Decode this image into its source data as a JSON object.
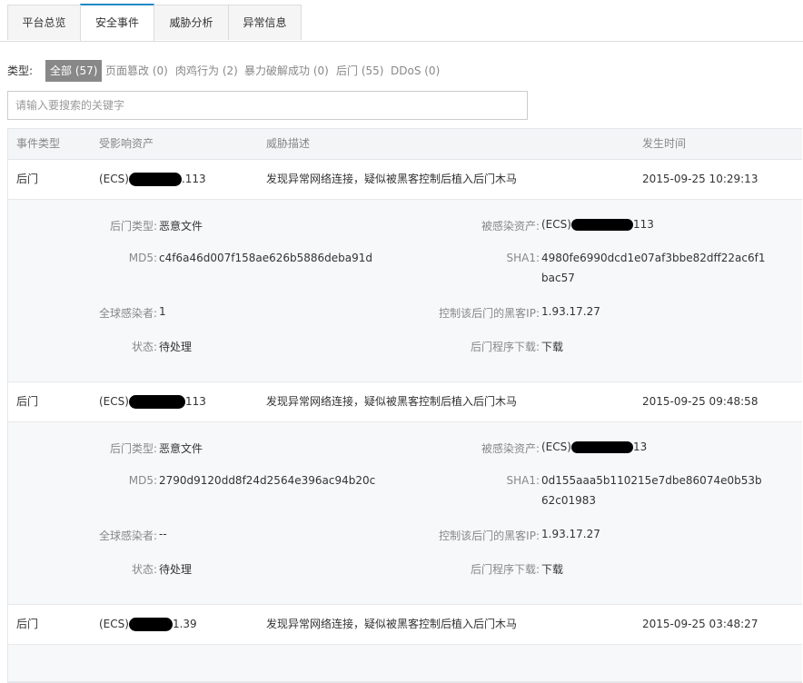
{
  "tabs": [
    {
      "label": "平台总览",
      "active": false
    },
    {
      "label": "安全事件",
      "active": true
    },
    {
      "label": "威胁分析",
      "active": false
    },
    {
      "label": "异常信息",
      "active": false
    }
  ],
  "filter": {
    "label": "类型:",
    "options": [
      {
        "label": "全部 (57)",
        "selected": true
      },
      {
        "label": "页面篡改 (0)"
      },
      {
        "label": "肉鸡行为 (2)"
      },
      {
        "label": "暴力破解成功 (0)"
      },
      {
        "label": "后门 (55)"
      },
      {
        "label": "DDoS (0)"
      }
    ]
  },
  "search": {
    "placeholder": "请输入要搜索的关键字",
    "value": ""
  },
  "table": {
    "headers": [
      "事件类型",
      "受影响资产",
      "威胁描述",
      "发生时间"
    ],
    "rows": [
      {
        "type": "后门",
        "asset_prefix": "(ECS)",
        "asset_suffix": ".113",
        "desc_pre": "发现",
        "desc_link": "异常网络连接",
        "desc_post": "，疑似被黑客控制后植入后门木马",
        "time": "2015-09-25 10:29:13",
        "detail": {
          "backdoor_type_label": "后门类型:",
          "backdoor_type": "恶意文件",
          "infected_asset_label": "被感染资产:",
          "infected_asset_prefix": "(ECS)",
          "infected_asset_suffix": "113",
          "md5_label": "MD5:",
          "md5": "c4f6a46d007f158ae626b5886deba91d",
          "sha1_label": "SHA1:",
          "sha1": "4980fe6990dcd1e07af3bbe82dff22ac6f1bac57",
          "global_label": "全球感染者:",
          "global": "1",
          "hacker_ip_label": "控制该后门的黑客IP:",
          "hacker_ip": "1.93.17.27",
          "status_label": "状态:",
          "status": "待处理",
          "download_label": "后门程序下载:",
          "download": "下载"
        }
      },
      {
        "type": "后门",
        "asset_prefix": "(ECS)",
        "asset_suffix": "113",
        "desc_pre": "发现",
        "desc_link": "异常网络连接",
        "desc_post": "，疑似被黑客控制后植入后门木马",
        "time": "2015-09-25 09:48:58",
        "detail": {
          "backdoor_type_label": "后门类型:",
          "backdoor_type": "恶意文件",
          "infected_asset_label": "被感染资产:",
          "infected_asset_prefix": "(ECS)",
          "infected_asset_suffix": "13",
          "md5_label": "MD5:",
          "md5": "2790d9120dd8f24d2564e396ac94b20c",
          "sha1_label": "SHA1:",
          "sha1": "0d155aaa5b110215e7dbe86074e0b53b62c01983",
          "global_label": "全球感染者:",
          "global": "--",
          "hacker_ip_label": "控制该后门的黑客IP:",
          "hacker_ip": "1.93.17.27",
          "status_label": "状态:",
          "status": "待处理",
          "download_label": "后门程序下载:",
          "download": "下载"
        }
      },
      {
        "type": "后门",
        "asset_prefix": "(ECS)",
        "asset_suffix": "1.39",
        "desc_pre": "发现",
        "desc_link": "异常网络连接",
        "desc_post": "，疑似被黑客控制后植入后门木马",
        "time": "2015-09-25 03:48:27"
      }
    ]
  },
  "colors": {
    "accent": "#1e88c7",
    "link": "#1e6fb8",
    "selected_filter_bg": "#888888"
  }
}
